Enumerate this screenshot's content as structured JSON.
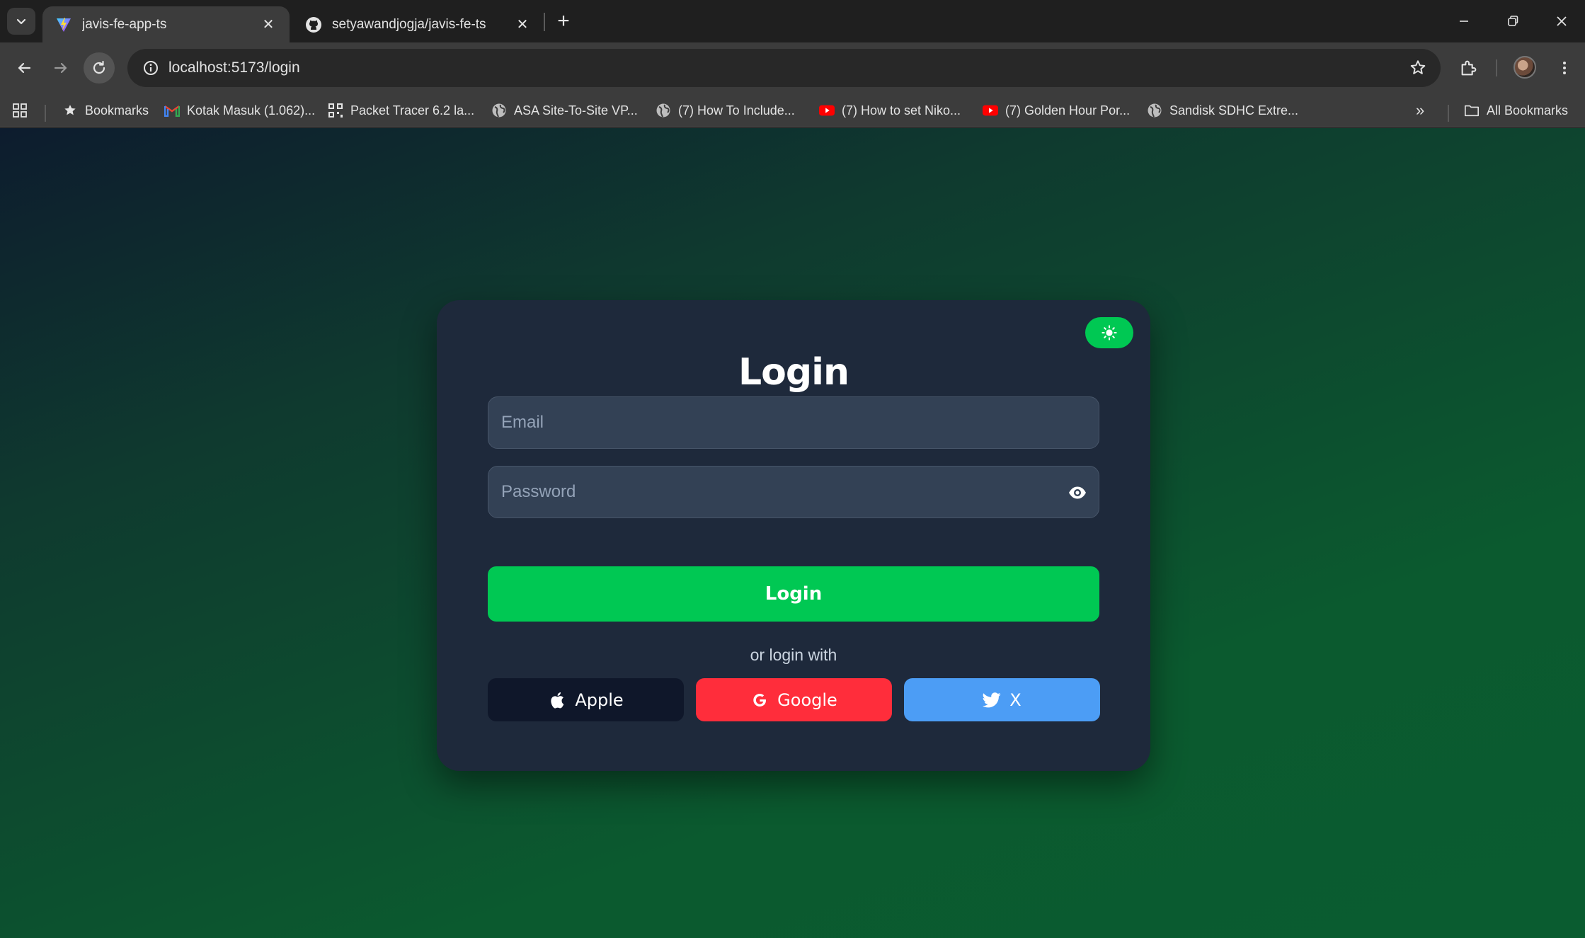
{
  "browser": {
    "tabs": [
      {
        "title": "javis-fe-app-ts",
        "active": true,
        "favicon": "vite-icon"
      },
      {
        "title": "setyawandjogja/javis-fe-ts",
        "active": false,
        "favicon": "github-icon"
      }
    ],
    "new_tab_label": "+",
    "address": {
      "host": "localhost",
      "path": ":5173/login"
    },
    "bookmarks": [
      {
        "label": "Bookmarks",
        "icon": "star-icon"
      },
      {
        "label": "Kotak Masuk (1.062)...",
        "icon": "gmail-icon"
      },
      {
        "label": "Packet Tracer 6.2 la...",
        "icon": "qr-icon"
      },
      {
        "label": "ASA Site-To-Site VP...",
        "icon": "globe-icon"
      },
      {
        "label": "(7) How To Include...",
        "icon": "globe-icon"
      },
      {
        "label": "(7) How to set Niko...",
        "icon": "youtube-icon"
      },
      {
        "label": "(7) Golden Hour Por...",
        "icon": "youtube-icon"
      },
      {
        "label": "Sandisk SDHC Extre...",
        "icon": "globe-icon"
      }
    ],
    "overflow_label": "»",
    "all_bookmarks_label": "All Bookmarks"
  },
  "login": {
    "title": "Login",
    "email_placeholder": "Email",
    "password_placeholder": "Password",
    "submit_label": "Login",
    "divider_text": "or login with",
    "social": [
      {
        "label": "Apple",
        "icon": "apple-icon",
        "color": "#0f172a"
      },
      {
        "label": "Google",
        "icon": "google-icon",
        "color": "#ff2d3b"
      },
      {
        "label": "X",
        "icon": "twitter-icon",
        "color": "#4c9df5"
      }
    ],
    "theme_toggle_icon": "sun-icon"
  },
  "colors": {
    "accent": "#00c853",
    "card": "#1e293b",
    "input": "#334155"
  }
}
